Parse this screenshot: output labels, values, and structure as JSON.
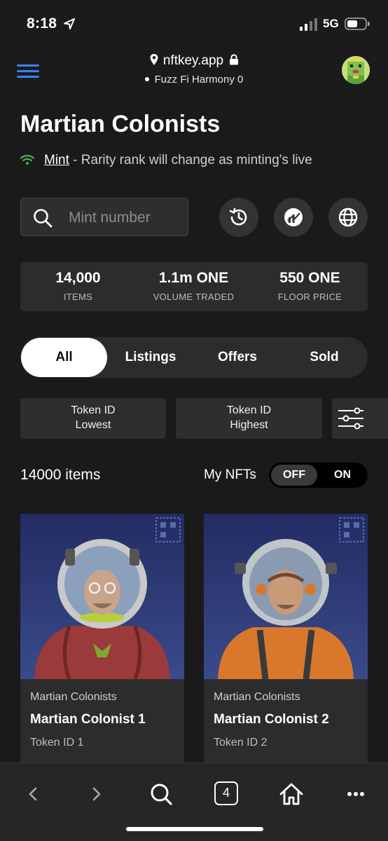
{
  "status": {
    "time": "8:18",
    "network": "5G"
  },
  "browser": {
    "url": "nftkey.app",
    "network_label": "Fuzz Fi Harmony 0"
  },
  "page": {
    "title": "Martian Colonists",
    "mint_link": "Mint",
    "mint_note": " - Rarity rank will change as minting's live"
  },
  "search": {
    "placeholder": "Mint number"
  },
  "actions": [
    "history-icon",
    "chart-icon",
    "globe-icon"
  ],
  "stats": [
    {
      "value": "14,000",
      "label": "ITEMS"
    },
    {
      "value": "1.1m ONE",
      "label": "VOLUME TRADED"
    },
    {
      "value": "550 ONE",
      "label": "FLOOR PRICE"
    }
  ],
  "tabs": [
    {
      "label": "All",
      "active": true
    },
    {
      "label": "Listings",
      "active": false
    },
    {
      "label": "Offers",
      "active": false
    },
    {
      "label": "Sold",
      "active": false
    }
  ],
  "sort": [
    {
      "line1": "Token ID",
      "line2": "Lowest"
    },
    {
      "line1": "Token ID",
      "line2": "Highest"
    }
  ],
  "listing": {
    "count": "14000 items",
    "my_nfts_label": "My NFTs",
    "toggle_off": "OFF",
    "toggle_on": "ON",
    "toggle_state": "OFF"
  },
  "cards": [
    {
      "collection": "Martian Colonists",
      "name": "Martian Colonist 1",
      "token": "Token ID 1",
      "suit_color": "#9a3a3a"
    },
    {
      "collection": "Martian Colonists",
      "name": "Martian Colonist 2",
      "token": "Token ID 2",
      "suit_color": "#d9782a"
    }
  ],
  "toolbar": {
    "tabs_count": "4"
  },
  "colors": {
    "accent": "#3b82f6",
    "background": "#1a1a1a",
    "card_art_bg": "#2b3468"
  }
}
